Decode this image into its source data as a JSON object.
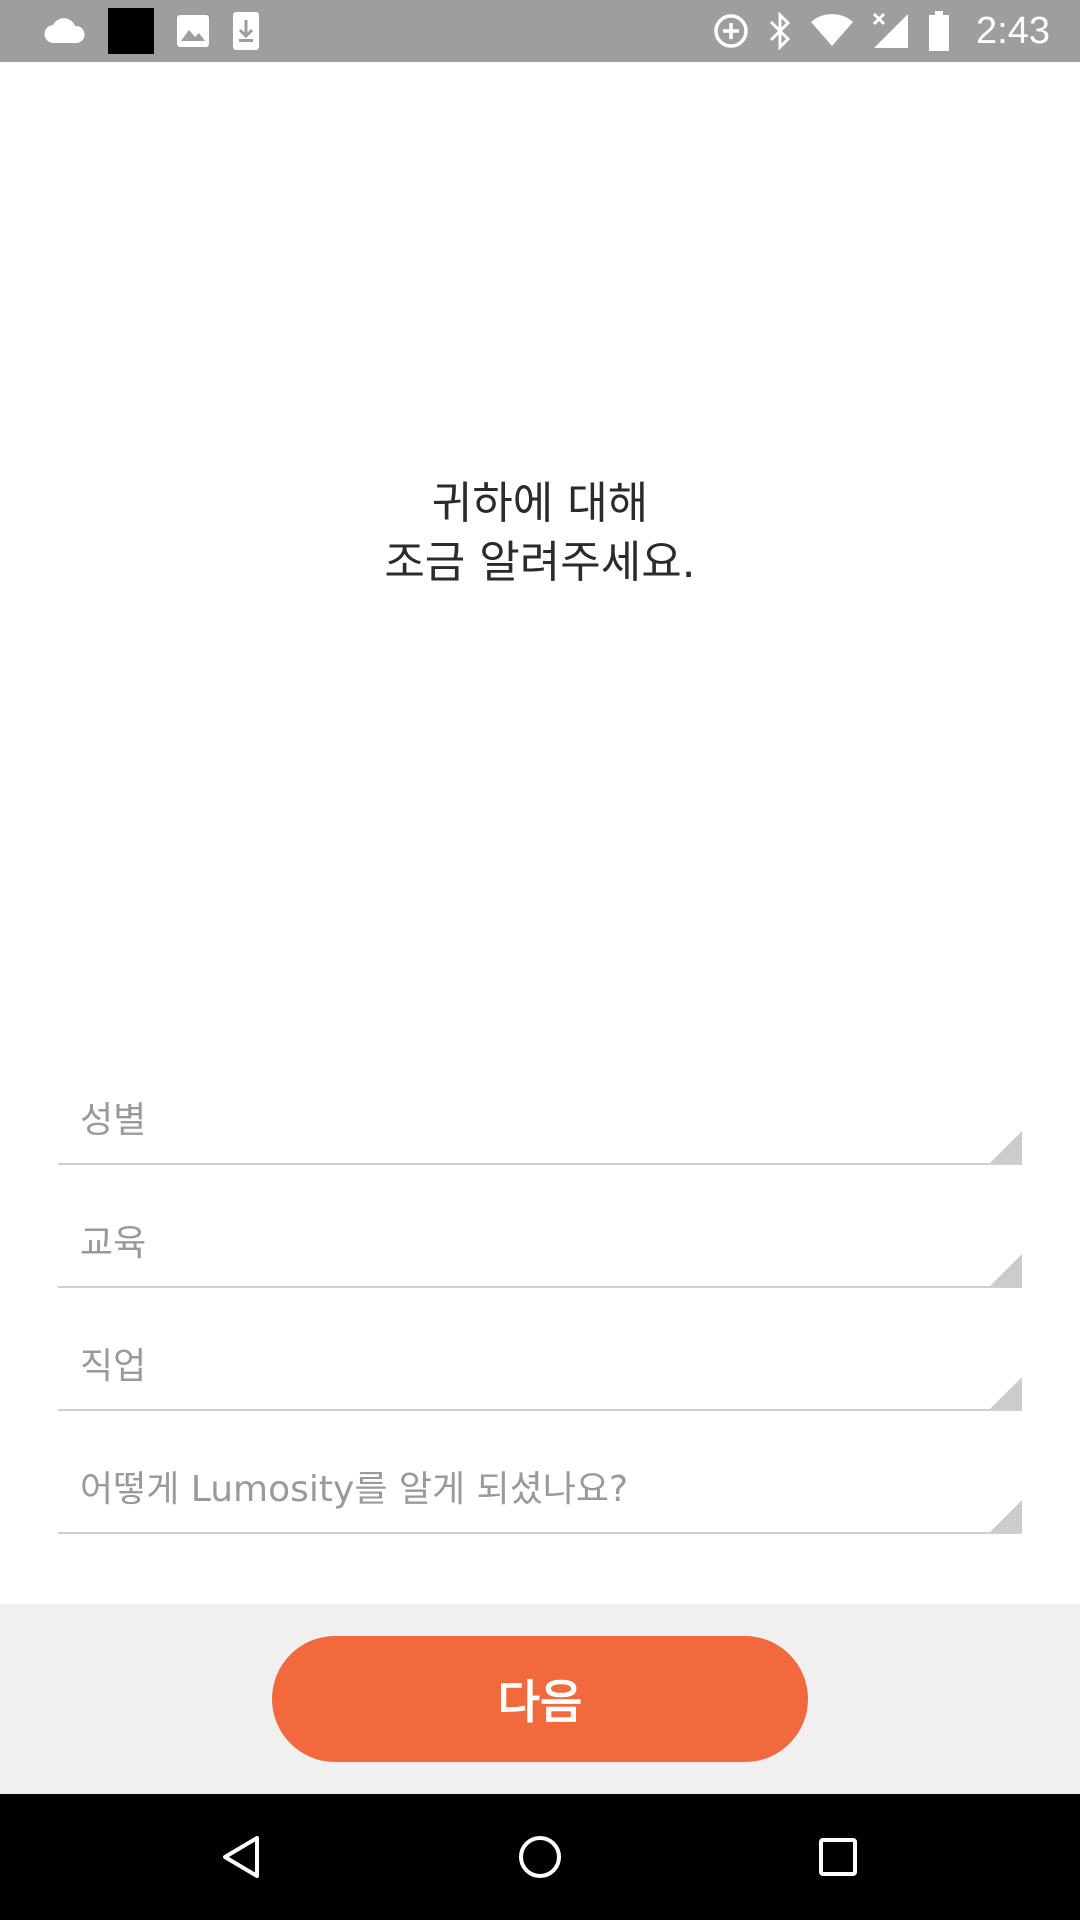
{
  "status_bar": {
    "time": "2:43",
    "left_icons": [
      "cloud-icon",
      "black-square-icon",
      "image-icon",
      "download-icon"
    ],
    "right_icons": [
      "data-saver-icon",
      "bluetooth-icon",
      "wifi-icon",
      "signal-icon",
      "battery-icon"
    ],
    "background_color": "#9e9e9e"
  },
  "main": {
    "headline_line1": "귀하에 대해",
    "headline_line2": "조금 알려주세요.",
    "fields": [
      {
        "label": "성별"
      },
      {
        "label": "교육"
      },
      {
        "label": "직업"
      },
      {
        "label": "어떻게 Lumosity를 알게 되셨나요?"
      }
    ]
  },
  "footer": {
    "next_label": "다음",
    "accent_color": "#f2693d"
  },
  "nav_bar": {
    "icons": [
      "back-icon",
      "home-icon",
      "recents-icon"
    ]
  }
}
